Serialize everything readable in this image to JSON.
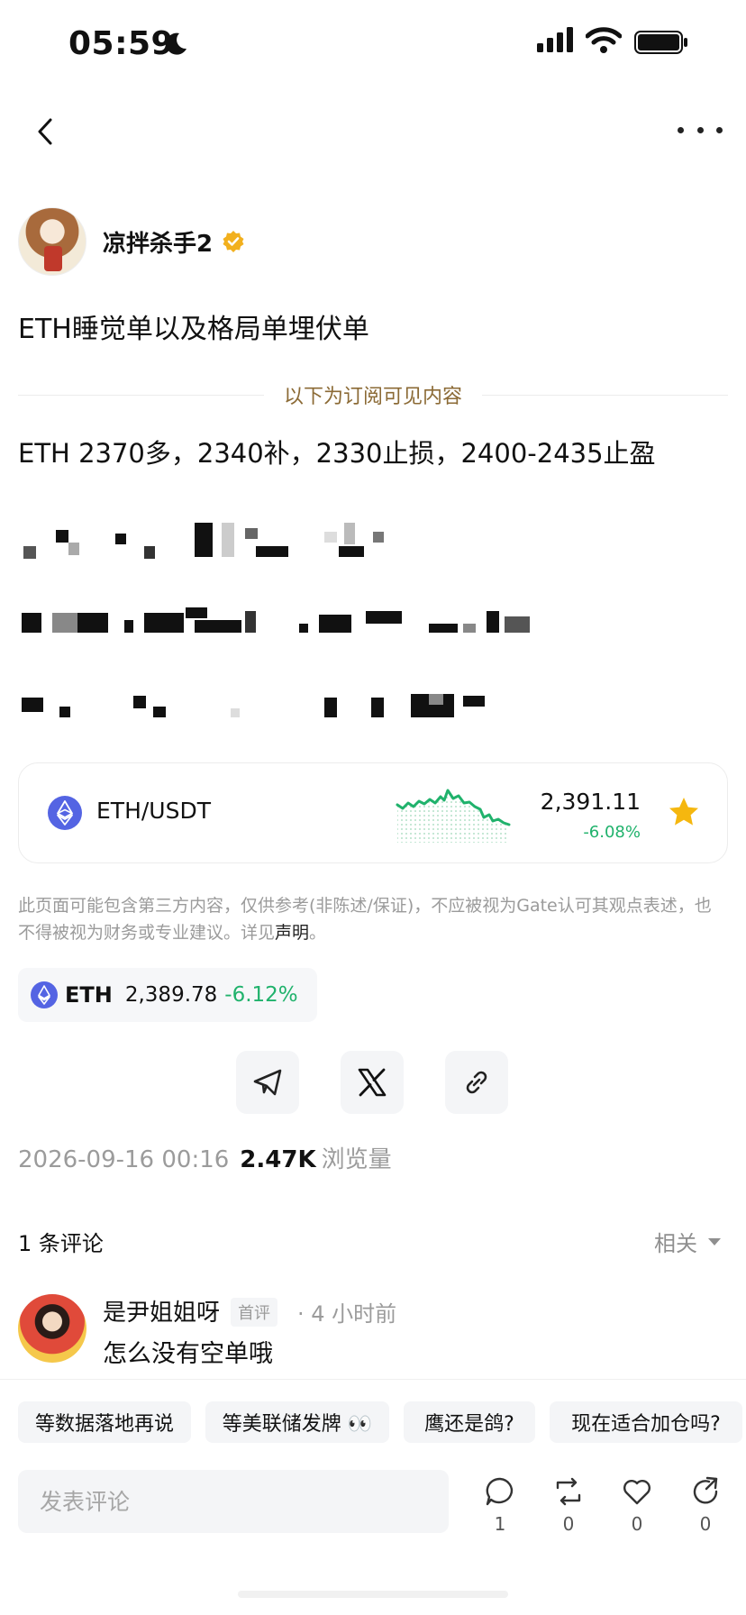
{
  "status_bar": {
    "time": "05:59",
    "icons": [
      "moon-icon",
      "signal-icon",
      "wifi-icon",
      "battery-icon"
    ]
  },
  "nav": {
    "back_icon": "chevron-left-icon",
    "more_icon": "more-horizontal-icon"
  },
  "author": {
    "name": "凉拌杀手2",
    "verified_icon": "verified-badge-icon"
  },
  "post": {
    "title": "ETH睡觉单以及格局单埋伏单",
    "subscriber_divider": "以下为订阅可见内容",
    "visible_text": "ETH 2370多，2340补，2330止损，2400-2435止盈"
  },
  "pair_card": {
    "name": "ETH/USDT",
    "price": "2,391.11",
    "change": "-6.08%",
    "favorited": true,
    "accent": "#20b26c"
  },
  "disclaimer": {
    "text": "此页面可能包含第三方内容，仅供参考(非陈述/保证)，不应被视为Gate认可其观点表述，也不得被视为财务或专业建议。详见",
    "link": "声明",
    "end": "。"
  },
  "token_chip": {
    "symbol": "ETH",
    "price": "2,389.78",
    "change": "-6.12%"
  },
  "share": [
    "telegram-icon",
    "x-icon",
    "link-icon"
  ],
  "meta": {
    "datetime": "2026-09-16 00:16",
    "views": "2.47K",
    "views_label": "浏览量"
  },
  "comments": {
    "count_label": "1 条评论",
    "sort": "相关",
    "items": [
      {
        "name": "是尹姐姐呀",
        "badge": "首评",
        "time": "· 4 小时前",
        "text": "怎么没有空单哦"
      }
    ]
  },
  "quick_replies": [
    "等数据落地再说",
    "等美联储发牌 👀",
    "鹰还是鸽?",
    "现在适合加仓吗?"
  ],
  "composer": {
    "placeholder": "发表评论",
    "actions": [
      {
        "icon": "comment-icon",
        "count": "1"
      },
      {
        "icon": "repost-icon",
        "count": "0"
      },
      {
        "icon": "like-icon",
        "count": "0"
      },
      {
        "icon": "share-icon",
        "count": "0"
      }
    ]
  }
}
